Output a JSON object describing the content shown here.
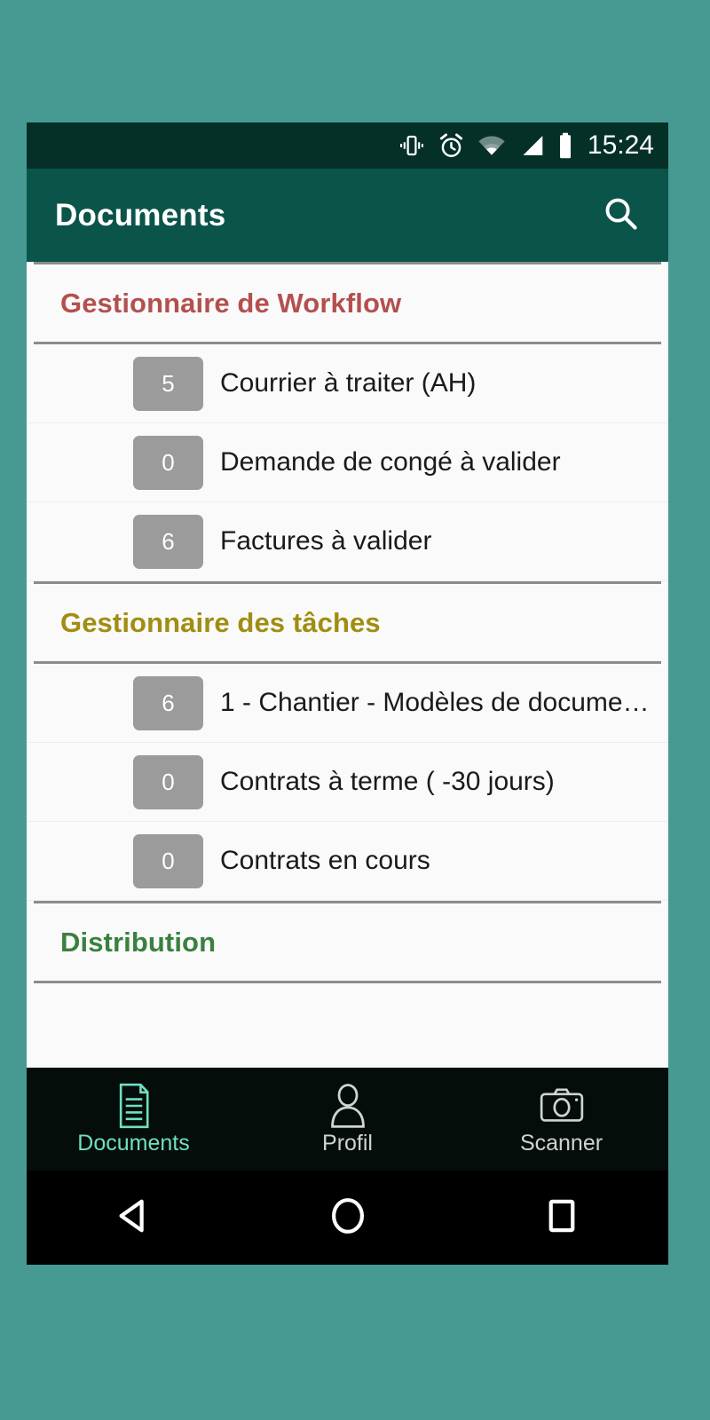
{
  "theme": {
    "page_background": "#479a92",
    "appbar_color": "#0b5449",
    "statusbar_color": "#053028",
    "tabbar_color": "#050d0b",
    "navbar_color": "#000000",
    "badge_color": "#9b9b9b",
    "accent_red": "#b3504f",
    "accent_gold": "#a08d12",
    "accent_green": "#3a8040",
    "active_tab_color": "#6fe0c0"
  },
  "status_bar": {
    "time": "15:24",
    "icons": [
      "vibrate-icon",
      "alarm-icon",
      "wifi-icon",
      "signal-icon",
      "battery-icon"
    ]
  },
  "app_bar": {
    "title": "Documents",
    "search_icon": "search-icon"
  },
  "sections": [
    {
      "id": "workflow",
      "title": "Gestionnaire de Workflow",
      "color_key": "sec-red",
      "items": [
        {
          "count": "5",
          "label": "Courrier à traiter (AH)"
        },
        {
          "count": "0",
          "label": "Demande de congé à valider"
        },
        {
          "count": "6",
          "label": "Factures à valider"
        }
      ]
    },
    {
      "id": "taches",
      "title": "Gestionnaire des tâches",
      "color_key": "sec-gold",
      "items": [
        {
          "count": "6",
          "label": "1 - Chantier - Modèles de docume…"
        },
        {
          "count": "0",
          "label": "Contrats à terme ( -30 jours)"
        },
        {
          "count": "0",
          "label": "Contrats en cours"
        }
      ]
    },
    {
      "id": "distribution",
      "title": "Distribution",
      "color_key": "sec-green",
      "items": []
    }
  ],
  "tab_bar": {
    "tabs": [
      {
        "id": "documents",
        "label": "Documents",
        "icon": "document-icon",
        "active": true
      },
      {
        "id": "profil",
        "label": "Profil",
        "icon": "person-icon",
        "active": false
      },
      {
        "id": "scanner",
        "label": "Scanner",
        "icon": "camera-icon",
        "active": false
      }
    ]
  },
  "nav_bar": {
    "buttons": [
      {
        "id": "back",
        "icon": "back-triangle-icon"
      },
      {
        "id": "home",
        "icon": "home-circle-icon"
      },
      {
        "id": "recents",
        "icon": "recents-square-icon"
      }
    ]
  }
}
